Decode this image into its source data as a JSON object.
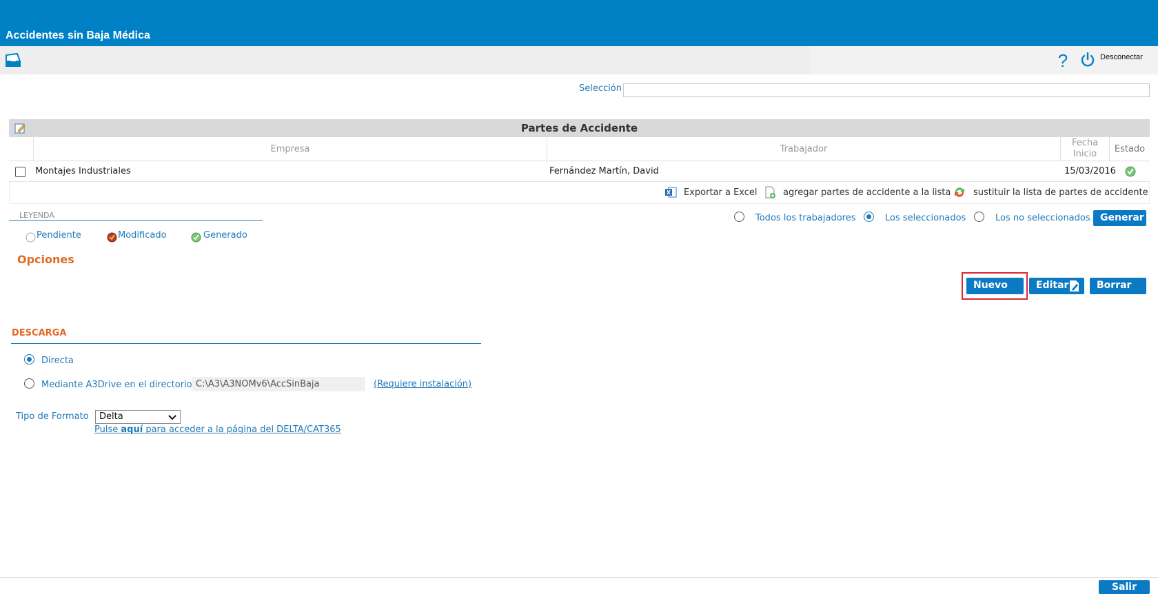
{
  "window": {
    "title": "Accidentes sin Baja Médica"
  },
  "toolbar": {
    "disconnect_label": "Desconectar",
    "help_glyph": "?"
  },
  "seleccion": {
    "label": "Selección",
    "value": ""
  },
  "grid": {
    "title": "Partes de Accidente",
    "columns": [
      "Empresa",
      "Trabajador",
      "Fecha",
      "Inicio",
      "Estado"
    ],
    "rows": [
      {
        "empresa": "Montajes Industriales",
        "trabajador": "Fernández Martín, David",
        "fecha_inicio": "15/03/2016",
        "estado": "Generado",
        "checked": false
      }
    ],
    "footer": {
      "export": "Exportar a Excel",
      "add": "agregar partes de accidente a la lista",
      "replace": "sustituir la lista de partes de accidente"
    }
  },
  "leyenda": {
    "title": "LEYENDA",
    "items": [
      "Pendiente",
      "Modificado",
      "Generado"
    ]
  },
  "filter": {
    "options": [
      "Todos los trabajadores",
      "Los seleccionados",
      "Los no seleccionados"
    ],
    "selected": "Los seleccionados",
    "generate_label": "Generar"
  },
  "opciones": {
    "title": "Opciones",
    "nuevo": "Nuevo",
    "editar": "Editar",
    "borrar": "Borrar"
  },
  "descarga": {
    "title": "DESCARGA",
    "directa": "Directa",
    "a3drive": "Mediante A3Drive en el directorio",
    "path": "C:\\A3\\A3NOMv6\\AccSinBaja",
    "requiere": "(Requiere instalación)",
    "selected": "Directa"
  },
  "formato": {
    "label": "Tipo de Formato",
    "value": "Delta",
    "pulse": "Pulse",
    "aqui": "aquí",
    "rest": "para acceder a la página del DELTA/CAT365"
  },
  "footer": {
    "salir": "Salir"
  },
  "colors": {
    "brand": "#0081c6",
    "accent_orange": "#e06a26",
    "link_blue": "#1f7ab8",
    "highlight_red": "#d9272e"
  }
}
